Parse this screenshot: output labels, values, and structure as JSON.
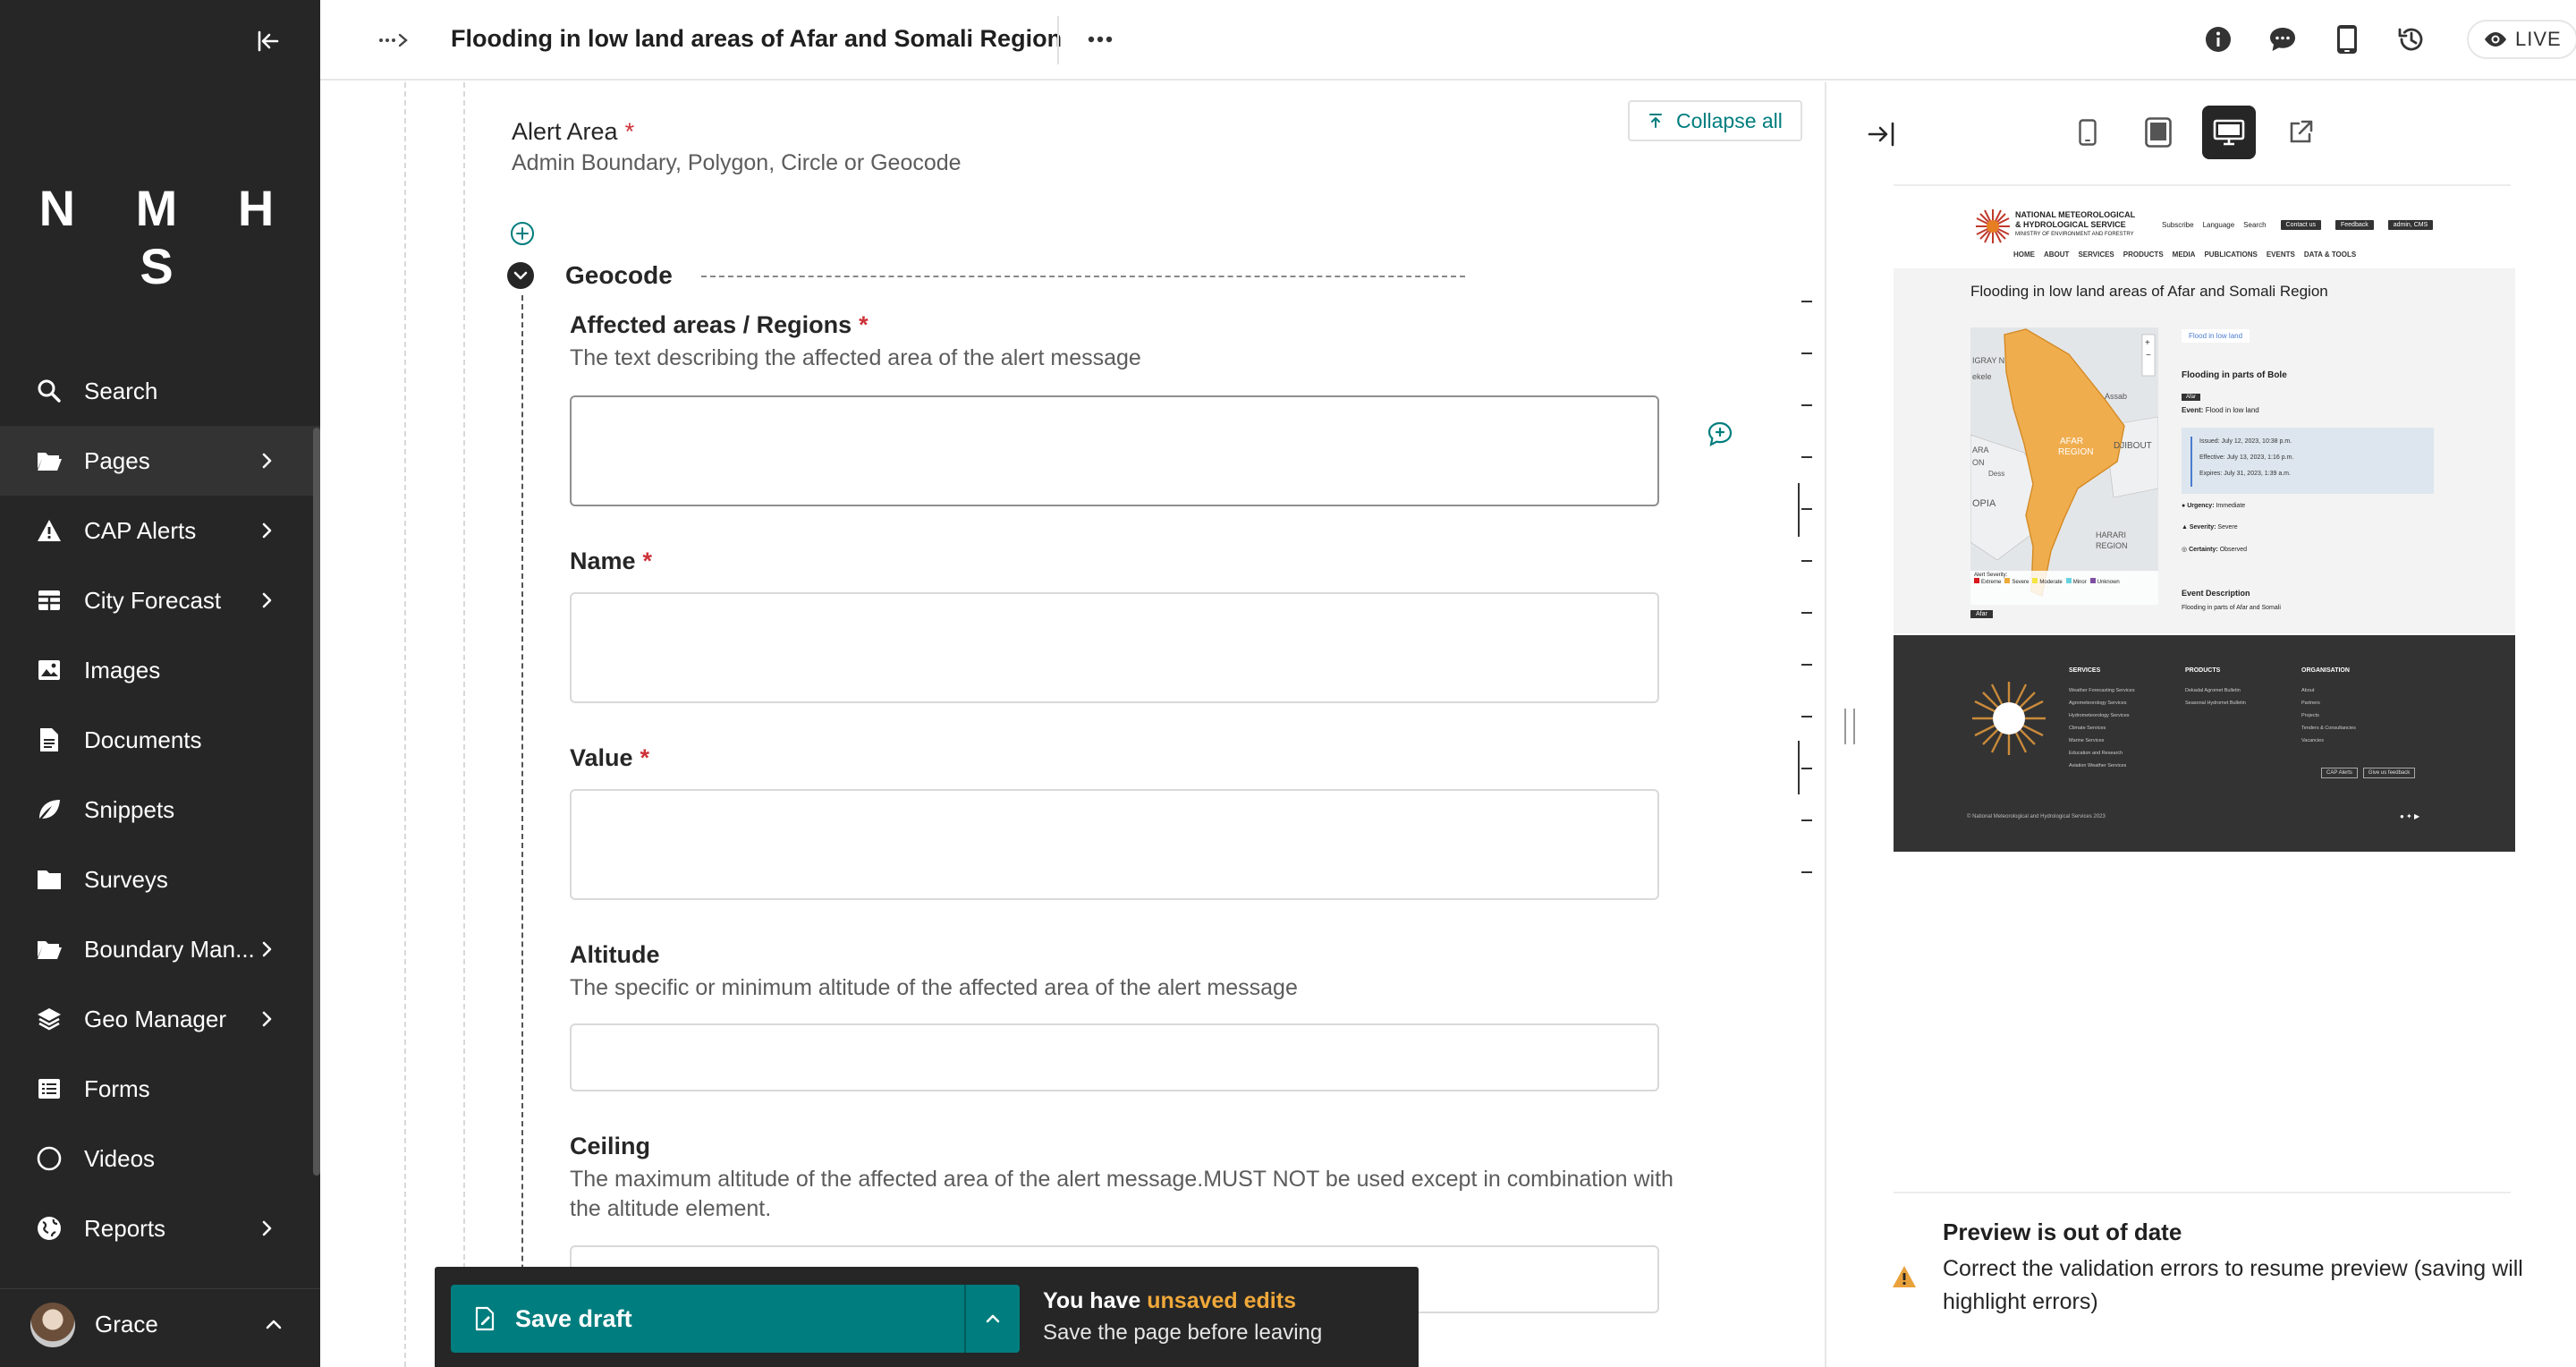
{
  "sidebar": {
    "logo": "N M H S",
    "items": [
      {
        "label": "Search",
        "icon": "search-icon",
        "has_children": false
      },
      {
        "label": "Pages",
        "icon": "folder-open-icon",
        "has_children": true,
        "active": true
      },
      {
        "label": "CAP Alerts",
        "icon": "warning-icon",
        "has_children": true
      },
      {
        "label": "City Forecast",
        "icon": "table-icon",
        "has_children": true
      },
      {
        "label": "Images",
        "icon": "image-icon",
        "has_children": false
      },
      {
        "label": "Documents",
        "icon": "document-icon",
        "has_children": false
      },
      {
        "label": "Snippets",
        "icon": "snippet-icon",
        "has_children": false
      },
      {
        "label": "Surveys",
        "icon": "folder-icon",
        "has_children": false
      },
      {
        "label": "Boundary Man...",
        "icon": "folder-open-icon",
        "has_children": true
      },
      {
        "label": "Geo Manager",
        "icon": "layers-icon",
        "has_children": true
      },
      {
        "label": "Forms",
        "icon": "list-icon",
        "has_children": false
      },
      {
        "label": "Videos",
        "icon": "circle-icon",
        "has_children": false
      },
      {
        "label": "Reports",
        "icon": "globe-icon",
        "has_children": true
      }
    ],
    "user": {
      "name": "Grace"
    }
  },
  "header": {
    "title": "Flooding in low land areas of Afar and Somali Region",
    "live_label": "LIVE"
  },
  "editor": {
    "area": {
      "label": "Alert Area",
      "help": "Admin Boundary, Polygon, Circle or Geocode",
      "collapse_all": "Collapse all"
    },
    "block": {
      "title": "Geocode"
    },
    "fields": {
      "affected": {
        "label": "Affected areas / Regions",
        "help": "The text describing the affected area of the alert message",
        "value": ""
      },
      "name": {
        "label": "Name",
        "value": ""
      },
      "value": {
        "label": "Value",
        "value": ""
      },
      "altitude": {
        "label": "Altitude",
        "help": "The specific or minimum altitude of the affected area of the alert message",
        "value": ""
      },
      "ceiling": {
        "label": "Ceiling",
        "help": "The maximum altitude of the affected area of the alert message.MUST NOT be used except in combination with the altitude element.",
        "value": ""
      }
    }
  },
  "savebar": {
    "save_label": "Save draft",
    "unsaved_prefix": "You have ",
    "unsaved_highlight": "unsaved edits",
    "unsaved_sub": "Save the page before leaving"
  },
  "preview": {
    "out_of_date_title": "Preview is out of date",
    "out_of_date_msg": "Correct the validation errors to resume preview (saving will highlight errors)",
    "site": {
      "org_line1": "NATIONAL METEOROLOGICAL",
      "org_line2": "& HYDROLOGICAL SERVICE",
      "org_line3": "MINISTRY OF ENVIRONMENT AND FORESTRY",
      "top_links": [
        "Subscribe",
        "Language",
        "Search"
      ],
      "top_buttons": [
        "Contact us",
        "Feedback",
        "admin, CMS"
      ],
      "nav": [
        "HOME",
        "ABOUT",
        "SERVICES",
        "PRODUCTS",
        "MEDIA",
        "PUBLICATIONS",
        "EVENTS",
        "DATA & TOOLS"
      ],
      "alert_title": "Flooding in low land areas of Afar and Somali Region",
      "tab": "Flood in low land",
      "info_title": "Flooding in parts of Bole",
      "tag": "Afar",
      "event_label": "Event:",
      "event_value": "Flood in low land",
      "issued": "Issued: July 12, 2023, 10:38 p.m.",
      "effective": "Effective: July 13, 2023, 1:16 p.m.",
      "expires": "Expires: July 31, 2023, 1:39 a.m.",
      "urgency_label": "Urgency:",
      "urgency_value": "Immediate",
      "severity_label": "Severity:",
      "severity_value": "Severe",
      "certainty_label": "Certainty:",
      "certainty_value": "Observed",
      "desc_title": "Event Description",
      "desc_text": "Flooding in parts of Afar and Somali",
      "map_labels": [
        "IGRAY N",
        "ekele",
        "AFAR",
        "REGION",
        "Assab",
        "DJIBOUT",
        "ARA",
        "ON",
        "Dess",
        "OPIA",
        "HARARI",
        "REGION"
      ],
      "legend_title": "Alert Severity:",
      "legend": [
        "Extreme",
        "Severe",
        "Moderate",
        "Minor",
        "Unknown"
      ],
      "legend_colors": [
        "#d7191c",
        "#f0a83a",
        "#f4e542",
        "#67d3e0",
        "#7d4fa3"
      ],
      "map_tag": "Afar",
      "footer_cols": [
        {
          "title": "SERVICES",
          "items": [
            "Weather Forecasting Services",
            "Agrometeorology Services",
            "Hydrometeorology Services",
            "Climate Services",
            "Marine Services",
            "Education and Research",
            "Aviation Weather Services"
          ]
        },
        {
          "title": "PRODUCTS",
          "items": [
            "Dekadal Agromet Bulletin",
            "Seasonal Hydromet Bulletin"
          ]
        },
        {
          "title": "ORGANISATION",
          "items": [
            "About",
            "Partners",
            "Projects",
            "Tenders & Consultancies",
            "Vacancies"
          ]
        }
      ],
      "footer_buttons": [
        "CAP Alerts",
        "Give us feedback"
      ],
      "copyright": "© National Meteorological and Hydrological Services 2023"
    }
  }
}
